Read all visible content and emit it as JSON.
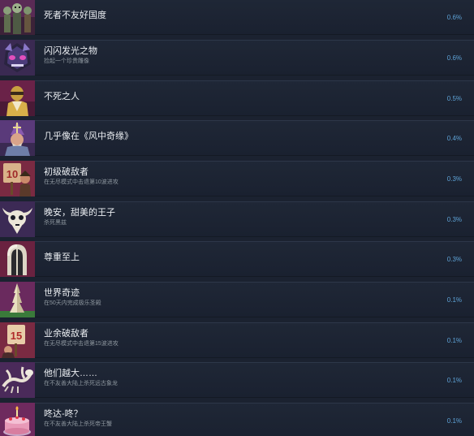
{
  "achievements": [
    {
      "title": "死者不友好国度",
      "desc": "",
      "percent": "0.6%",
      "icon": "zombies-icon",
      "accent": "#9c3a88"
    },
    {
      "title": "闪闪发光之物",
      "desc": "捡起一个珍贵雕像",
      "percent": "0.6%",
      "icon": "demon-idol-icon",
      "accent": "#6a3fa8"
    },
    {
      "title": "不死之人",
      "desc": "",
      "percent": "0.5%",
      "icon": "golden-warrior-icon",
      "accent": "#8a2f5f"
    },
    {
      "title": "几乎像在《风中奇缘》",
      "desc": "",
      "percent": "0.4%",
      "icon": "bishop-icon",
      "accent": "#7a3a9a"
    },
    {
      "title": "初级破敌者",
      "desc": "在无尽模式中击退第10波进攻",
      "percent": "0.3%",
      "icon": "sign-10-icon",
      "accent": "#8b2a4a"
    },
    {
      "title": "晚安，甜美的王子",
      "desc": "杀死黑兹",
      "percent": "0.3%",
      "icon": "horned-skull-icon",
      "accent": "#4a2a6a"
    },
    {
      "title": "尊重至上",
      "desc": "",
      "percent": "0.3%",
      "icon": "knight-helmet-icon",
      "accent": "#8a2a50"
    },
    {
      "title": "世界奇迹",
      "desc": "在50天内完成极乐圣殿",
      "percent": "0.1%",
      "icon": "tower-icon",
      "accent": "#7a2a6a"
    },
    {
      "title": "业余破敌者",
      "desc": "在无尽模式中击退第15波进攻",
      "percent": "0.1%",
      "icon": "sign-15-icon",
      "accent": "#8b2a4a"
    },
    {
      "title": "他们越大……",
      "desc": "在不友善大陆上杀死远古象龙",
      "percent": "0.1%",
      "icon": "bone-dragon-icon",
      "accent": "#5a2a6a"
    },
    {
      "title": "咚达-咚？",
      "desc": "在不友善大陆上杀死帝王蟹",
      "percent": "0.1%",
      "icon": "cake-icon",
      "accent": "#8a3a7a"
    }
  ]
}
